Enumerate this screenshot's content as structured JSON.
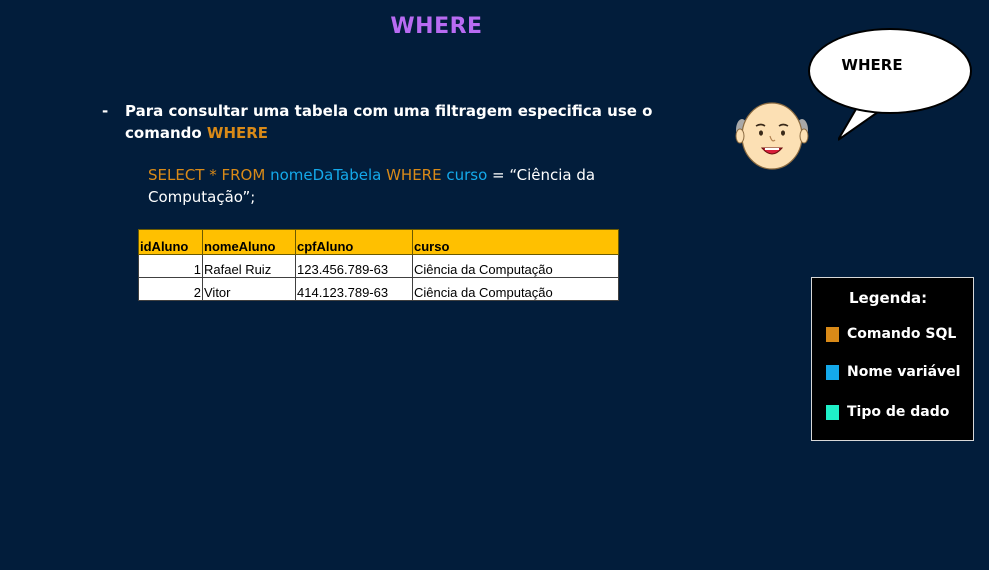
{
  "slide": {
    "title": "WHERE"
  },
  "bullet": {
    "marker": "-",
    "text": "Para consultar uma tabela com uma filtragem especifica use o comando ",
    "keyword": "WHERE"
  },
  "code": {
    "select": "SELECT * FROM ",
    "table_name": "nomeDaTabela",
    "where": " WHERE ",
    "column": "curso",
    "rest": " = “Ciência da Computação”;"
  },
  "table": {
    "headers": [
      "idAluno",
      "nomeAluno",
      "cpfAluno",
      "curso"
    ],
    "rows": [
      [
        "1",
        "Rafael Ruiz",
        "123.456.789-63",
        "Ciência da Computação"
      ],
      [
        "2",
        "Vitor",
        "414.123.789-63",
        "Ciência da Computação"
      ]
    ]
  },
  "speech_bubble": {
    "text": "WHERE"
  },
  "legend": {
    "title": "Legenda:",
    "items": [
      {
        "label": "Comando SQL",
        "color": "#d98a18"
      },
      {
        "label": "Nome variável",
        "color": "#14a9ea"
      },
      {
        "label": "Tipo de dado",
        "color": "#1ff0c8"
      }
    ]
  },
  "colors": {
    "background": "#021d3b",
    "title": "#b86bf2",
    "sql_command": "#d98a18",
    "variable_name": "#14a9ea",
    "data_type": "#1ff0c8",
    "table_header": "#ffc000"
  }
}
